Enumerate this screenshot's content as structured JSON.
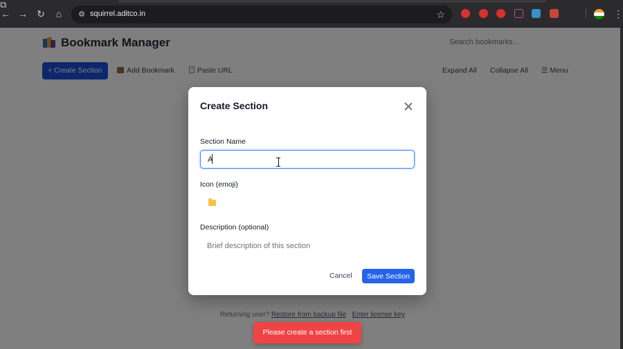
{
  "browser": {
    "url": "squirrel.aditco.in",
    "back_glyph": "←",
    "forward_glyph": "→",
    "reload_glyph": "↻",
    "home_glyph": "⌂",
    "site_info_glyph": "⚙",
    "bookmark_glyph": "☆",
    "extensions_glyph": "⧉",
    "menu_glyph": "⋮"
  },
  "header": {
    "title": "Bookmark Manager",
    "search_placeholder": "Search bookmarks..."
  },
  "toolbar": {
    "create_section_label": "+ Create Section",
    "add_bookmark_label": "Add Bookmark",
    "paste_url_label": "Paste URL",
    "expand_all_label": "Expand All",
    "collapse_all_label": "Collapse All",
    "menu_label": "☰ Menu"
  },
  "footer": {
    "prefix": "Returning user?",
    "restore_label": "Restore from backup file",
    "license_label": "Enter license key"
  },
  "modal": {
    "title": "Create Section",
    "section_name_label": "Section Name",
    "section_name_value": "A",
    "icon_label": "Icon (emoji)",
    "description_label": "Description (optional)",
    "description_placeholder": "Brief description of this section",
    "cancel_label": "Cancel",
    "save_label": "Save Section"
  },
  "toast": {
    "message": "Please create a section first"
  },
  "colors": {
    "primary": "#1d4ed8",
    "toast": "#ef4444"
  }
}
